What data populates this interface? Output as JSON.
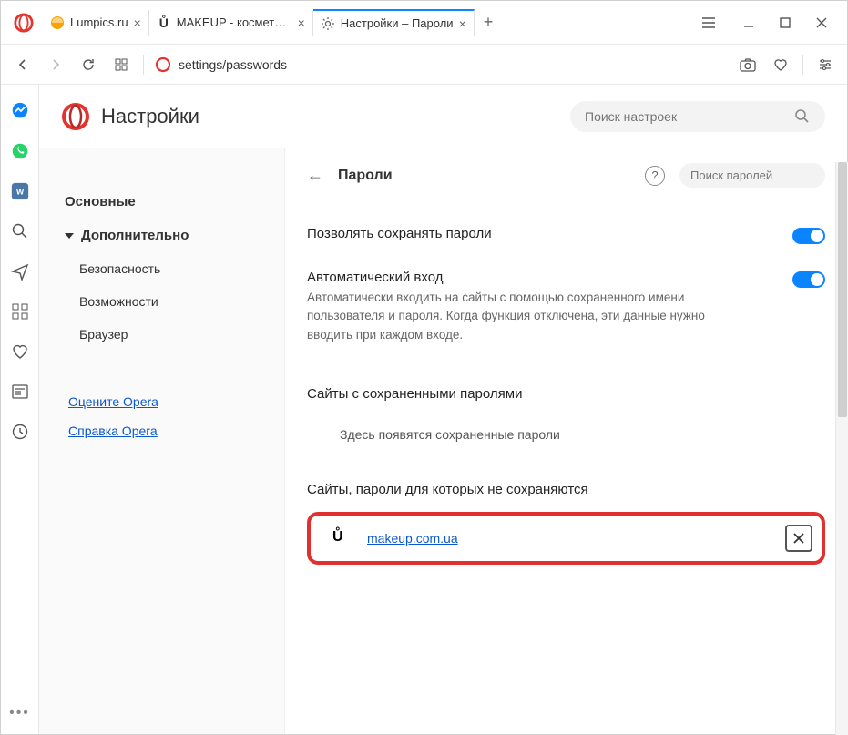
{
  "tabs": [
    {
      "title": "Lumpics.ru"
    },
    {
      "title": "MAKEUP - косметика и па"
    },
    {
      "title": "Настройки – Пароли"
    }
  ],
  "address": "settings/passwords",
  "settings": {
    "title": "Настройки",
    "search_placeholder": "Поиск настроек"
  },
  "nav": {
    "basic": "Основные",
    "advanced": "Дополнительно",
    "security": "Безопасность",
    "features": "Возможности",
    "browser": "Браузер",
    "rate": "Оцените Opera",
    "help": "Справка Opera"
  },
  "panel": {
    "title": "Пароли",
    "search_placeholder": "Поиск паролей",
    "allow_save": "Позволять сохранять пароли",
    "auto_login_title": "Автоматический вход",
    "auto_login_desc": "Автоматически входить на сайты с помощью сохраненного имени пользователя и пароля. Когда функция отключена, эти данные нужно вводить при каждом входе.",
    "saved_title": "Сайты с сохраненными паролями",
    "saved_empty": "Здесь появятся сохраненные пароли",
    "never_title": "Сайты, пароли для которых не сохраняются",
    "never_site": "makeup.com.ua"
  }
}
